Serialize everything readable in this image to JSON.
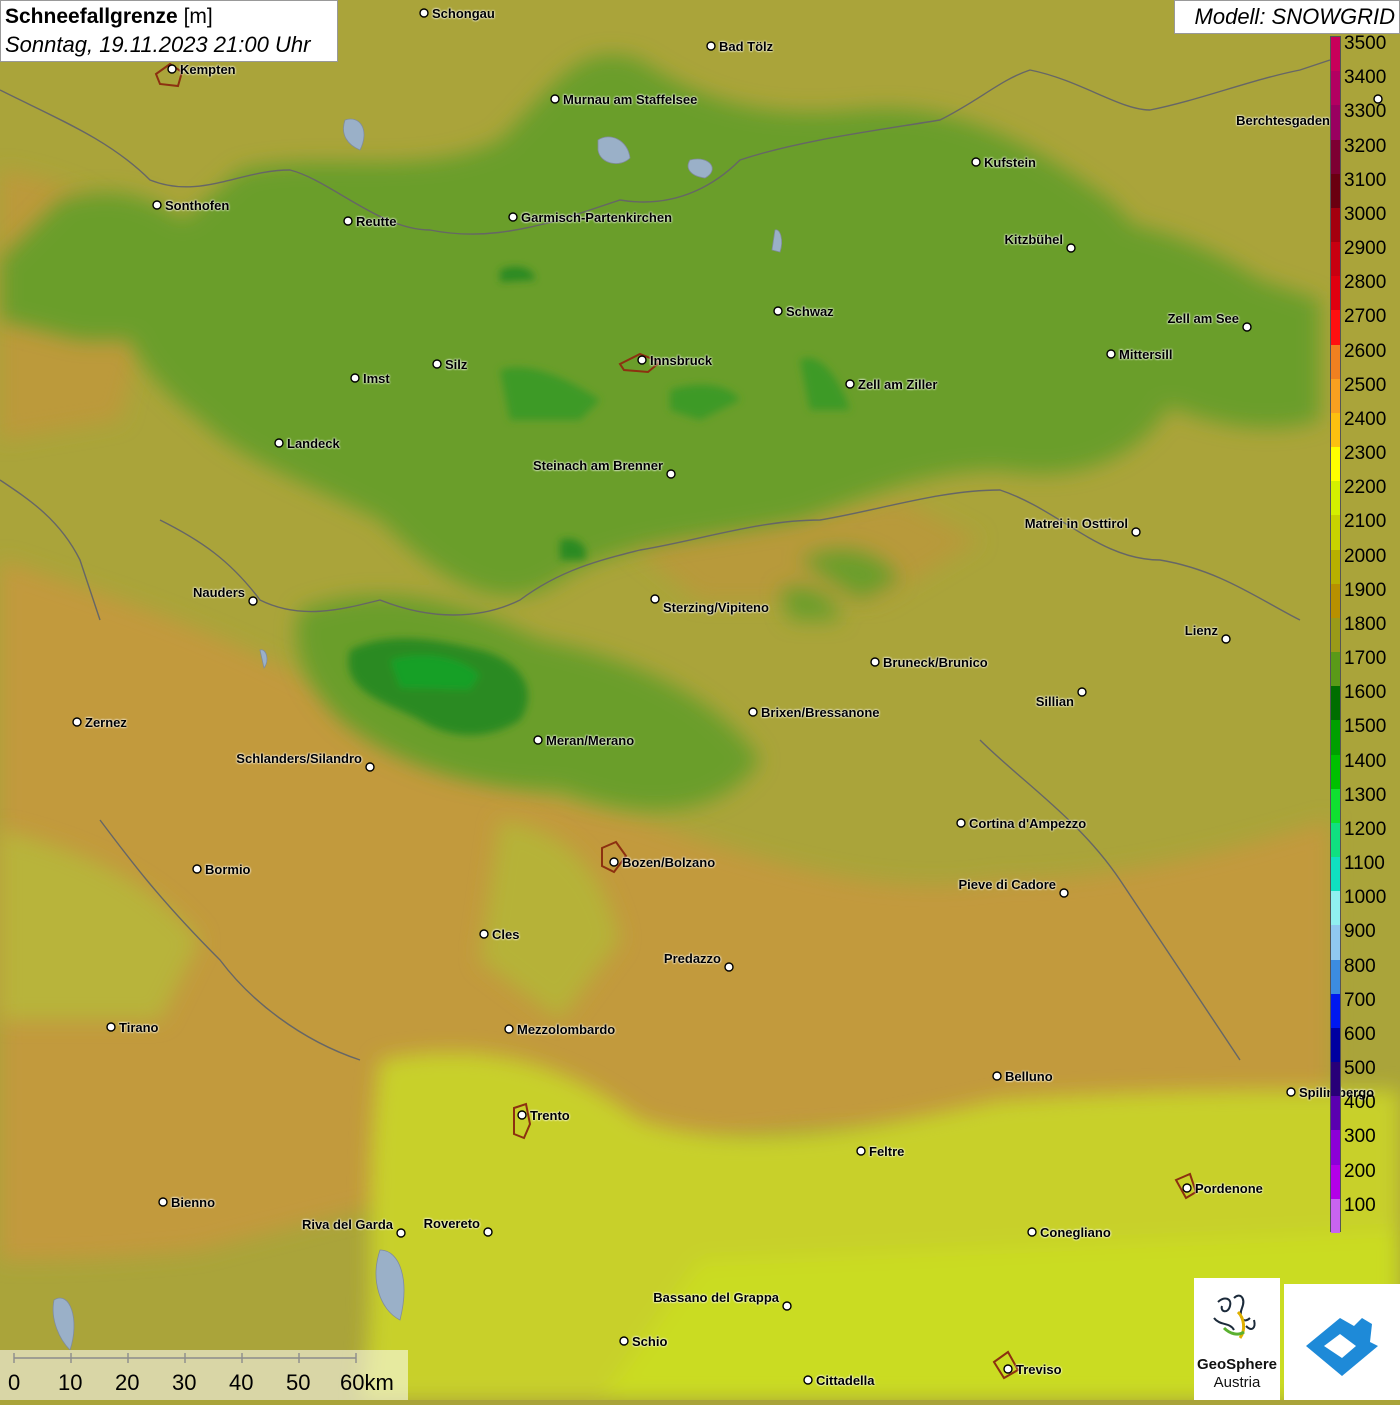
{
  "title": {
    "main": "Schneefallgrenze",
    "unit": "[m]",
    "datetime": "Sonntag, 19.11.2023 21:00 Uhr"
  },
  "model": "Modell: SNOWGRID",
  "legend": {
    "labels": [
      "3500",
      "3400",
      "3300",
      "3200",
      "3100",
      "3000",
      "2900",
      "2800",
      "2700",
      "2600",
      "2500",
      "2400",
      "2300",
      "2200",
      "2100",
      "2000",
      "1900",
      "1800",
      "1700",
      "1600",
      "1500",
      "1400",
      "1300",
      "1200",
      "1100",
      "1000",
      "900",
      "800",
      "700",
      "600",
      "500",
      "400",
      "300",
      "200",
      "100"
    ],
    "colors": [
      "#c8005a",
      "#b30061",
      "#9a0060",
      "#7d0032",
      "#6a0010",
      "#a4000e",
      "#c80010",
      "#e0000f",
      "#ff1010",
      "#f08020",
      "#f8a020",
      "#fcc010",
      "#ffff00",
      "#d4f000",
      "#c8d200",
      "#b8b000",
      "#b89000",
      "#9a9a18",
      "#5a9a18",
      "#006e00",
      "#00a000",
      "#00c000",
      "#10e030",
      "#10e080",
      "#10e0c0",
      "#90f0f0",
      "#90c8f0",
      "#3c8ce0",
      "#0018f0",
      "#0000a0",
      "#280078",
      "#5a00b0",
      "#8c00d8",
      "#b400e8",
      "#c864f0"
    ]
  },
  "scale": {
    "ticks": [
      "0",
      "10",
      "20",
      "30",
      "40",
      "50",
      "60km"
    ]
  },
  "logos": {
    "geosphere_line1": "GeoSphere",
    "geosphere_line2": "Austria"
  },
  "cities": [
    {
      "name": "Schongau"
    },
    {
      "name": "Bad Tölz"
    },
    {
      "name": "Kempten"
    },
    {
      "name": "Murnau am Staffelsee"
    },
    {
      "name": "Kufstein"
    },
    {
      "name": "Berchtesgaden"
    },
    {
      "name": "Sonthofen"
    },
    {
      "name": "Reutte"
    },
    {
      "name": "Garmisch-Partenkirchen"
    },
    {
      "name": "Kitzbühel"
    },
    {
      "name": "Schwaz"
    },
    {
      "name": "Zell am See"
    },
    {
      "name": "Innsbruck"
    },
    {
      "name": "Mittersill"
    },
    {
      "name": "Imst"
    },
    {
      "name": "Silz"
    },
    {
      "name": "Zell am Ziller"
    },
    {
      "name": "Landeck"
    },
    {
      "name": "Steinach am Brenner"
    },
    {
      "name": "Matrei in Osttirol"
    },
    {
      "name": "Nauders"
    },
    {
      "name": "Sterzing/Vipiteno"
    },
    {
      "name": "Lienz"
    },
    {
      "name": "Bruneck/Brunico"
    },
    {
      "name": "Sillian"
    },
    {
      "name": "Zernez"
    },
    {
      "name": "Brixen/Bressanone"
    },
    {
      "name": "Meran/Merano"
    },
    {
      "name": "Schlanders/Silandro"
    },
    {
      "name": "Cortina d'Ampezzo"
    },
    {
      "name": "Bormio"
    },
    {
      "name": "Bozen/Bolzano"
    },
    {
      "name": "Pieve di Cadore"
    },
    {
      "name": "Cles"
    },
    {
      "name": "Predazzo"
    },
    {
      "name": "Tirano"
    },
    {
      "name": "Mezzolombardo"
    },
    {
      "name": "Belluno"
    },
    {
      "name": "Trento"
    },
    {
      "name": "Feltre"
    },
    {
      "name": "Pordenone"
    },
    {
      "name": "Bienno"
    },
    {
      "name": "Riva del Garda"
    },
    {
      "name": "Rovereto"
    },
    {
      "name": "Conegliano"
    },
    {
      "name": "Bassano del Grappa"
    },
    {
      "name": "Schio"
    },
    {
      "name": "Cittadella"
    },
    {
      "name": "Treviso"
    },
    {
      "name": "Spilimbergo"
    }
  ]
}
